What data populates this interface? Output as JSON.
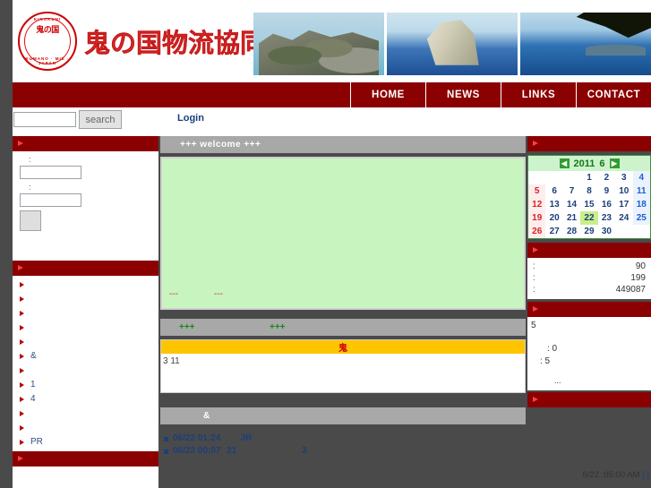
{
  "site": {
    "title": "鬼の国物流協同組合",
    "crest_top": "KINOKUNI",
    "crest_bottom": "KUMANO · MIE · JAPAN",
    "crest_center": "鬼の国"
  },
  "nav": {
    "items": [
      {
        "label": "HOME"
      },
      {
        "label": "NEWS"
      },
      {
        "label": "LINKS"
      },
      {
        "label": "CONTACT"
      }
    ]
  },
  "toolbar": {
    "search_value": "",
    "search_placeholder": "",
    "search_button": "search",
    "login_label": "Login"
  },
  "sidebar": {
    "login_panel": {
      "title": "",
      "user_label": ":",
      "user_value": "",
      "pass_label": ":",
      "pass_value": "",
      "submit_label": ""
    },
    "menu_title": "",
    "menu_items": [
      {
        "label": ""
      },
      {
        "label": ""
      },
      {
        "label": ""
      },
      {
        "label": ""
      },
      {
        "label": ""
      },
      {
        "label": "    &"
      },
      {
        "label": ""
      },
      {
        "label": "  1"
      },
      {
        "label": "  4"
      },
      {
        "label": ""
      },
      {
        "label": ""
      },
      {
        "label": "PR"
      }
    ],
    "bottom_bar_title": ""
  },
  "main": {
    "welcome_bar": "+++ welcome +++",
    "welcome_box": {
      "dash_left": "---",
      "dash_right": "---",
      "plus_left": "+++",
      "plus_right": "+++"
    },
    "section_bar_2": "",
    "notice": {
      "head_glyph": "鬼",
      "body_text": "3 11"
    },
    "news_bar": "&",
    "news_items": [
      {
        "date": "06/22 01:24",
        "title": "JR"
      },
      {
        "date": "06/22 00:07",
        "num": "21",
        "title": "3"
      }
    ]
  },
  "right": {
    "calendar_bar_title": "",
    "calendar": {
      "prev_arrow": "◀",
      "year": "2011",
      "month": "6",
      "next_arrow": "▶",
      "weeks": [
        [
          "",
          "",
          "",
          "1",
          "2",
          "3",
          "4"
        ],
        [
          "5",
          "6",
          "7",
          "8",
          "9",
          "10",
          "11"
        ],
        [
          "12",
          "13",
          "14",
          "15",
          "16",
          "17",
          "18"
        ],
        [
          "19",
          "20",
          "21",
          "22",
          "23",
          "24",
          "25"
        ],
        [
          "26",
          "27",
          "28",
          "29",
          "30",
          "",
          ""
        ]
      ],
      "today": "22"
    },
    "stats_bar_title": "",
    "stats": [
      {
        "label": ":",
        "value": "90"
      },
      {
        "label": ":",
        "value": "199"
      },
      {
        "label": ":",
        "value": "449087"
      }
    ],
    "info_bar_title": "",
    "info": {
      "line1": "5",
      "line2": ": 0",
      "line3": ": 5",
      "dots": "..."
    },
    "bottom_bar_title": "",
    "footer_time": "6/22 :05:00 AM",
    "footer_brackets": "[   ]"
  },
  "colors": {
    "brand_red": "#8b0000",
    "title_red": "#e03030",
    "gray_bar": "#a8a8a8",
    "green_box": "#c8f4c0",
    "yellow": "#ffc400",
    "today_green": "#c8f08a",
    "link_blue": "#1b3f7a"
  }
}
